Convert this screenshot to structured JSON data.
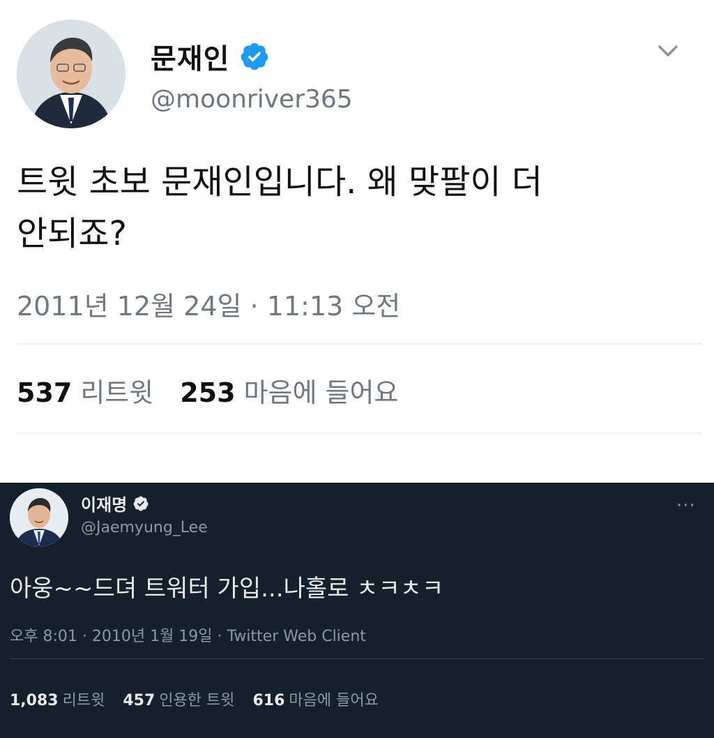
{
  "tweets": [
    {
      "theme": "light",
      "author": {
        "display_name": "문재인",
        "handle": "@moonriver365",
        "verified": true
      },
      "text_line1": "트윗 초보 문재인입니다. 왜 맞팔이 더",
      "text_line2": "안되죠?",
      "timestamp": "2011년 12월 24일 · 11:13 오전",
      "stats": {
        "retweets_count": "537",
        "retweets_label": "리트윗",
        "likes_count": "253",
        "likes_label": "마음에 들어요"
      },
      "icons": {
        "verified": "verified-badge-icon",
        "menu": "chevron-down-icon"
      }
    },
    {
      "theme": "dark",
      "author": {
        "display_name": "이재명",
        "handle": "@Jaemyung_Lee",
        "verified": true
      },
      "text": "아웅~~드뎌 트워터 가입...나홀로 ㅊㅋㅊㅋ",
      "meta": "오후 8:01 · 2010년 1월 19일 · Twitter Web Client",
      "stats": {
        "retweets_count": "1,083",
        "retweets_label": "리트윗",
        "quotes_count": "457",
        "quotes_label": "인용한 트윗",
        "likes_count": "616",
        "likes_label": "마음에 들어요"
      },
      "icons": {
        "verified": "verified-badge-icon",
        "menu": "more-dots-icon"
      },
      "menu_glyph": "···"
    }
  ],
  "colors": {
    "verified_blue": "#1d9bf0",
    "dark_background": "#15202b",
    "light_background": "#ffffff"
  }
}
